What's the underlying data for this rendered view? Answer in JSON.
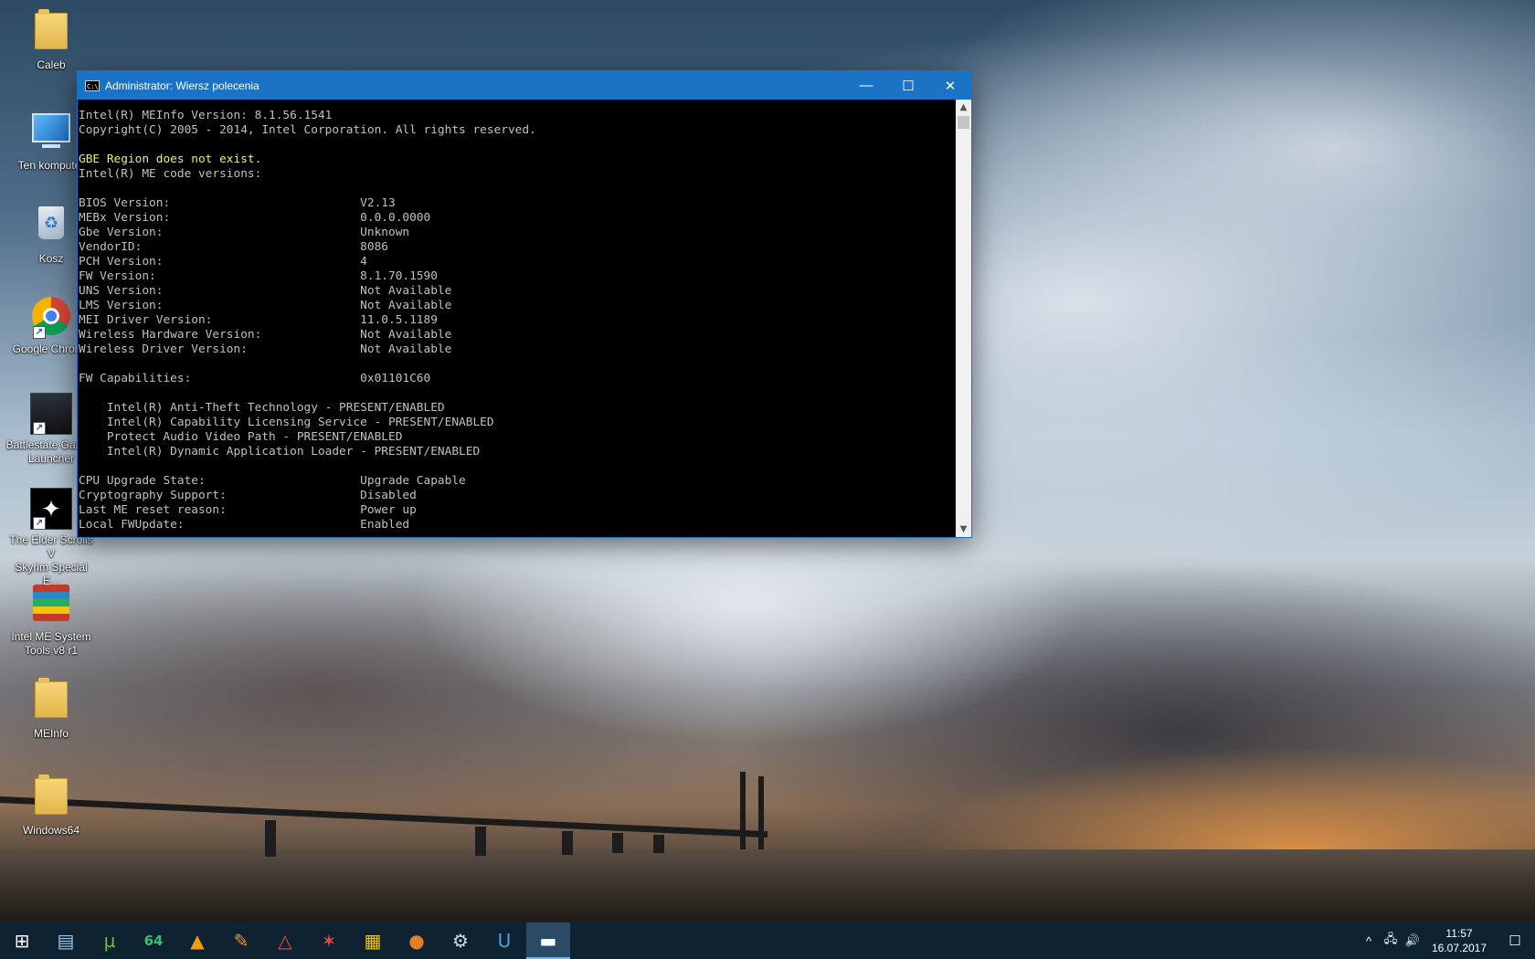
{
  "desktop": {
    "icons": [
      {
        "label": "Caleb",
        "icon": "user-folder-icon"
      },
      {
        "label": "Ten komputer",
        "icon": "computer-icon"
      },
      {
        "label": "Kosz",
        "icon": "recycle-bin-icon"
      },
      {
        "label": "Google Chrome",
        "icon": "chrome-icon"
      },
      {
        "label": "Battlestate Games\nLauncher",
        "icon": "battlestate-icon"
      },
      {
        "label": "The Elder Scrolls V\nSkyrim Special E...",
        "icon": "skyrim-icon"
      },
      {
        "label": "Intel ME System\nTools v8 r1",
        "icon": "winrar-archive-icon"
      },
      {
        "label": "MEInfo",
        "icon": "folder-icon"
      },
      {
        "label": "Windows64",
        "icon": "folder-icon"
      }
    ]
  },
  "window": {
    "title": "Administrator: Wiersz polecenia",
    "minimize": "—",
    "maximize": "☐",
    "close": "✕",
    "icon_text": "C:\\"
  },
  "console": {
    "lines": [
      {
        "text": "Intel(R) MEInfo Version: 8.1.56.1541",
        "color": "gray"
      },
      {
        "text": "Copyright(C) 2005 - 2014, Intel Corporation. All rights reserved.",
        "color": "gray"
      },
      {
        "text": "",
        "color": "gray"
      },
      {
        "text": "GBE Region does not exist.",
        "color": "yellow"
      },
      {
        "text": "Intel(R) ME code versions:",
        "color": "gray"
      },
      {
        "text": "",
        "color": "gray"
      },
      {
        "text": "BIOS Version:                           V2.13",
        "color": "gray"
      },
      {
        "text": "MEBx Version:                           0.0.0.0000",
        "color": "gray"
      },
      {
        "text": "Gbe Version:                            Unknown",
        "color": "gray"
      },
      {
        "text": "VendorID:                               8086",
        "color": "gray"
      },
      {
        "text": "PCH Version:                            4",
        "color": "gray"
      },
      {
        "text": "FW Version:                             8.1.70.1590",
        "color": "gray"
      },
      {
        "text": "UNS Version:                            Not Available",
        "color": "gray"
      },
      {
        "text": "LMS Version:                            Not Available",
        "color": "gray"
      },
      {
        "text": "MEI Driver Version:                     11.0.5.1189",
        "color": "gray"
      },
      {
        "text": "Wireless Hardware Version:              Not Available",
        "color": "gray"
      },
      {
        "text": "Wireless Driver Version:                Not Available",
        "color": "gray"
      },
      {
        "text": "",
        "color": "gray"
      },
      {
        "text": "FW Capabilities:                        0x01101C60",
        "color": "gray"
      },
      {
        "text": "",
        "color": "gray"
      },
      {
        "text": "    Intel(R) Anti-Theft Technology - PRESENT/ENABLED",
        "color": "gray"
      },
      {
        "text": "    Intel(R) Capability Licensing Service - PRESENT/ENABLED",
        "color": "gray"
      },
      {
        "text": "    Protect Audio Video Path - PRESENT/ENABLED",
        "color": "gray"
      },
      {
        "text": "    Intel(R) Dynamic Application Loader - PRESENT/ENABLED",
        "color": "gray"
      },
      {
        "text": "",
        "color": "gray"
      },
      {
        "text": "CPU Upgrade State:                      Upgrade Capable",
        "color": "gray"
      },
      {
        "text": "Cryptography Support:                   Disabled",
        "color": "gray"
      },
      {
        "text": "Last ME reset reason:                   Power up",
        "color": "gray"
      },
      {
        "text": "Local FWUpdate:                         Enabled",
        "color": "gray"
      }
    ]
  },
  "taskbar": {
    "items": [
      {
        "icon": "windows-start-icon",
        "glyph": "⊞"
      },
      {
        "icon": "file-explorer-icon",
        "glyph": "▤"
      },
      {
        "icon": "utorrent-icon",
        "glyph": "µ"
      },
      {
        "icon": "total-commander-64-icon",
        "glyph": "64"
      },
      {
        "icon": "avast-icon",
        "glyph": "▲"
      },
      {
        "icon": "pen-tool-icon",
        "glyph": "✎"
      },
      {
        "icon": "adobe-icon",
        "glyph": "△"
      },
      {
        "icon": "game-launcher-icon",
        "glyph": "✶"
      },
      {
        "icon": "clapperboard-icon",
        "glyph": "▦"
      },
      {
        "icon": "origin-icon",
        "glyph": "●"
      },
      {
        "icon": "steam-icon",
        "glyph": "⚙"
      },
      {
        "icon": "uplay-icon",
        "glyph": "U"
      },
      {
        "icon": "command-prompt-icon",
        "glyph": "▬"
      }
    ],
    "tray": {
      "chevron": "^",
      "network": "🖧",
      "volume": "🔊",
      "time": "11:57",
      "date": "16.07.2017",
      "notifications": "☐"
    }
  },
  "colors": {
    "titlebar": "#1a73c4",
    "console_bg": "#000000",
    "console_text": "#c0c0c0",
    "console_yellow": "#f1f15a",
    "taskbar": "#0f2232"
  }
}
